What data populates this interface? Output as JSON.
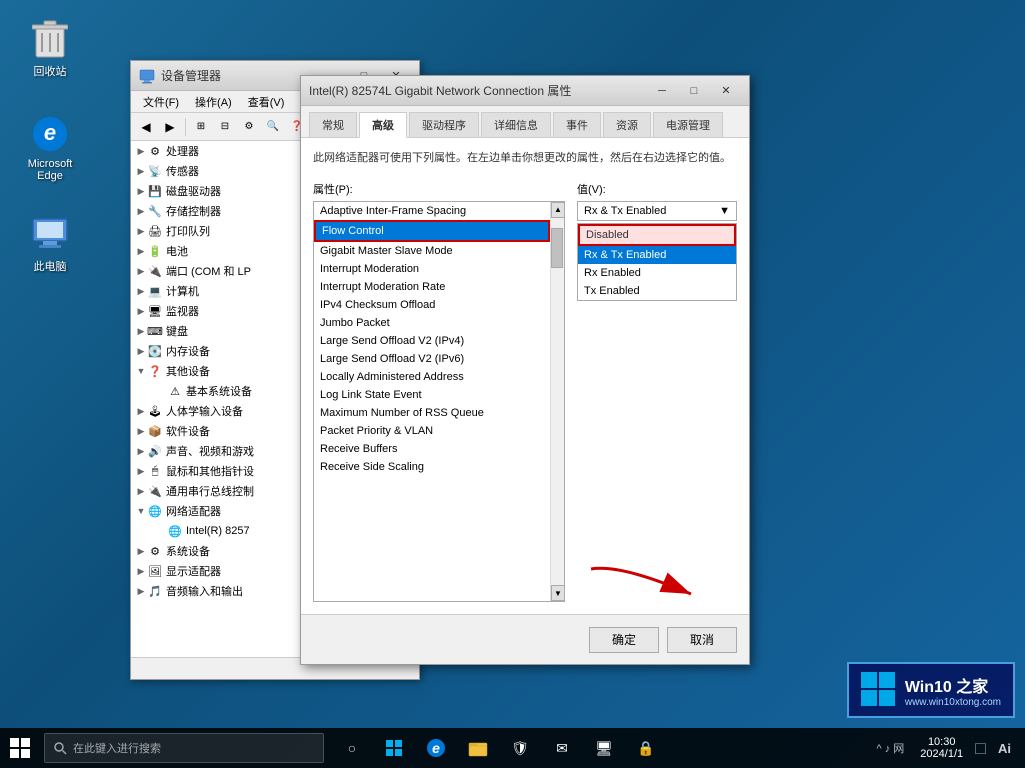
{
  "desktop": {
    "background": "#1565a0"
  },
  "icons": {
    "recycle_bin": {
      "label": "回收站",
      "icon": "🗑"
    },
    "edge": {
      "label": "Microsoft\nEdge",
      "icon": "e"
    },
    "computer": {
      "label": "此电脑",
      "icon": "💻"
    }
  },
  "taskbar": {
    "search_placeholder": "在此键入进行搜索",
    "start_icon": "⊞",
    "tray_icons": [
      "○",
      "⊟",
      "❑",
      "e",
      "📁",
      "🛡",
      "✉",
      "🖥",
      "🔒"
    ]
  },
  "device_manager": {
    "title": "设备管理器",
    "menu": [
      "文件(F)",
      "操作(A)",
      "查看(V)"
    ],
    "tree": [
      {
        "level": 1,
        "label": "处理器",
        "expanded": false,
        "icon": "💻"
      },
      {
        "level": 1,
        "label": "传感器",
        "expanded": false,
        "icon": "📡"
      },
      {
        "level": 1,
        "label": "磁盘驱动器",
        "expanded": false,
        "icon": "💾"
      },
      {
        "level": 1,
        "label": "存储控制器",
        "expanded": false,
        "icon": "🔧"
      },
      {
        "level": 1,
        "label": "打印队列",
        "expanded": false,
        "icon": "🖨"
      },
      {
        "level": 1,
        "label": "电池",
        "expanded": false,
        "icon": "🔋"
      },
      {
        "level": 1,
        "label": "端口 (COM 和 LP",
        "expanded": false,
        "icon": "🔌"
      },
      {
        "level": 1,
        "label": "计算机",
        "expanded": false,
        "icon": "💻"
      },
      {
        "level": 1,
        "label": "监视器",
        "expanded": false,
        "icon": "🖥"
      },
      {
        "level": 1,
        "label": "键盘",
        "expanded": false,
        "icon": "⌨"
      },
      {
        "level": 1,
        "label": "内存设备",
        "expanded": false,
        "icon": "💽"
      },
      {
        "level": 1,
        "label": "其他设备",
        "expanded": true,
        "icon": "❓"
      },
      {
        "level": 2,
        "label": "基本系统设备",
        "expanded": false,
        "icon": "⚙"
      },
      {
        "level": 1,
        "label": "人体学输入设备",
        "expanded": false,
        "icon": "🕹"
      },
      {
        "level": 1,
        "label": "软件设备",
        "expanded": false,
        "icon": "📦"
      },
      {
        "level": 1,
        "label": "声音、视频和游戏",
        "expanded": false,
        "icon": "🔊"
      },
      {
        "level": 1,
        "label": "鼠标和其他指针设",
        "expanded": false,
        "icon": "🖱"
      },
      {
        "level": 1,
        "label": "通用串行总线控制",
        "expanded": false,
        "icon": "🔌"
      },
      {
        "level": 1,
        "label": "网络适配器",
        "expanded": true,
        "icon": "🌐"
      },
      {
        "level": 2,
        "label": "Intel(R) 8257",
        "expanded": false,
        "icon": "🌐"
      },
      {
        "level": 1,
        "label": "系统设备",
        "expanded": false,
        "icon": "⚙"
      },
      {
        "level": 1,
        "label": "显示适配器",
        "expanded": false,
        "icon": "🖼"
      },
      {
        "level": 1,
        "label": "音频输入和输出",
        "expanded": false,
        "icon": "🎵"
      }
    ]
  },
  "prop_dialog": {
    "title": "Intel(R) 82574L Gigabit Network Connection 属性",
    "tabs": [
      "常规",
      "高级",
      "驱动程序",
      "详细信息",
      "事件",
      "资源",
      "电源管理"
    ],
    "active_tab": "高级",
    "description": "此网络适配器可使用下列属性。在左边单击你想更改的属性，然后在右边选择它的值。",
    "left_label": "属性(P):",
    "right_label": "值(V):",
    "property_list": [
      "Adaptive Inter-Frame Spacing",
      "Flow Control",
      "Gigabit Master Slave Mode",
      "Interrupt Moderation",
      "Interrupt Moderation Rate",
      "IPv4 Checksum Offload",
      "Jumbo Packet",
      "Large Send Offload V2 (IPv4)",
      "Large Send Offload V2 (IPv6)",
      "Locally Administered Address",
      "Log Link State Event",
      "Maximum Number of RSS Queue",
      "Packet Priority & VLAN",
      "Receive Buffers",
      "Receive Side Scaling"
    ],
    "selected_property": "Flow Control",
    "value_display": "Rx & Tx Enabled",
    "value_options": [
      {
        "label": "Disabled",
        "highlighted": true
      },
      {
        "label": "Rx & Tx Enabled",
        "selected": true
      },
      {
        "label": "Rx Enabled",
        "selected": false
      },
      {
        "label": "Tx Enabled",
        "selected": false
      }
    ],
    "ok_label": "确定",
    "cancel_label": "取消"
  },
  "win10_logo": {
    "text": "Win10 之家",
    "sub": "www.win10xtong.com"
  },
  "taskbar_ai": {
    "label": "Ai"
  }
}
